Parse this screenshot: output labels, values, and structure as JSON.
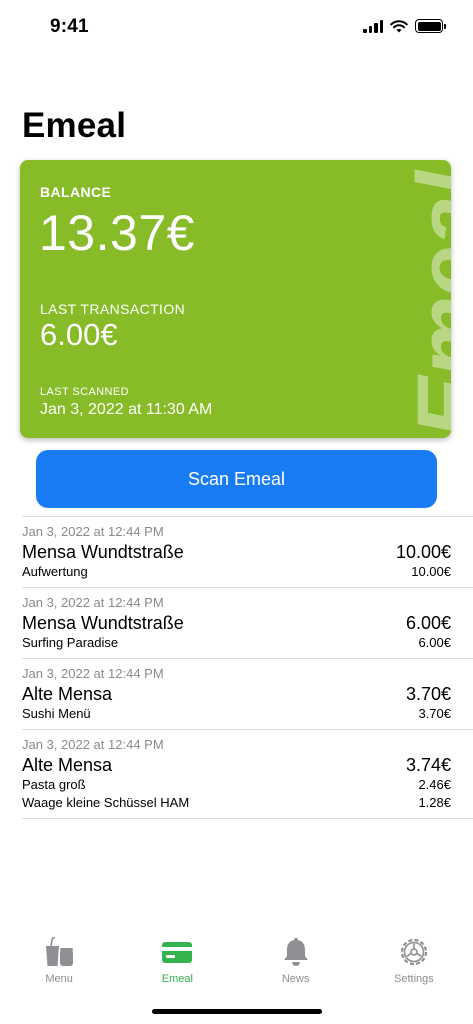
{
  "status_bar": {
    "time": "9:41"
  },
  "page": {
    "title": "Emeal"
  },
  "card": {
    "brand": "Emeal",
    "balance_label": "BALANCE",
    "balance_value": "13.37€",
    "last_transaction_label": "LAST TRANSACTION",
    "last_transaction_value": "6.00€",
    "last_scanned_label": "LAST SCANNED",
    "last_scanned_value": "Jan 3, 2022 at 11:30 AM",
    "color": "#87bb28"
  },
  "scan_button": {
    "label": "Scan Emeal",
    "color": "#1a7cf5"
  },
  "transactions": [
    {
      "date": "Jan 3, 2022 at 12:44 PM",
      "place": "Mensa Wundtstraße",
      "total": "10.00€",
      "lines": [
        {
          "name": "Aufwertung",
          "amount": "10.00€"
        }
      ]
    },
    {
      "date": "Jan 3, 2022 at 12:44 PM",
      "place": "Mensa Wundtstraße",
      "total": "6.00€",
      "lines": [
        {
          "name": "Surfing Paradise",
          "amount": "6.00€"
        }
      ]
    },
    {
      "date": "Jan 3, 2022 at 12:44 PM",
      "place": "Alte Mensa",
      "total": "3.70€",
      "lines": [
        {
          "name": "Sushi Menü",
          "amount": "3.70€"
        }
      ]
    },
    {
      "date": "Jan 3, 2022 at 12:44 PM",
      "place": "Alte Mensa",
      "total": "3.74€",
      "lines": [
        {
          "name": "Pasta groß",
          "amount": "2.46€"
        },
        {
          "name": "Waage kleine Schüssel HAM",
          "amount": "1.28€"
        }
      ]
    }
  ],
  "tab_bar": {
    "active_color": "#34b34f",
    "tabs": [
      {
        "label": "Menu",
        "icon": "menu-food-icon",
        "active": false
      },
      {
        "label": "Emeal",
        "icon": "card-icon",
        "active": true
      },
      {
        "label": "News",
        "icon": "bell-icon",
        "active": false
      },
      {
        "label": "Settings",
        "icon": "gear-icon",
        "active": false
      }
    ]
  }
}
